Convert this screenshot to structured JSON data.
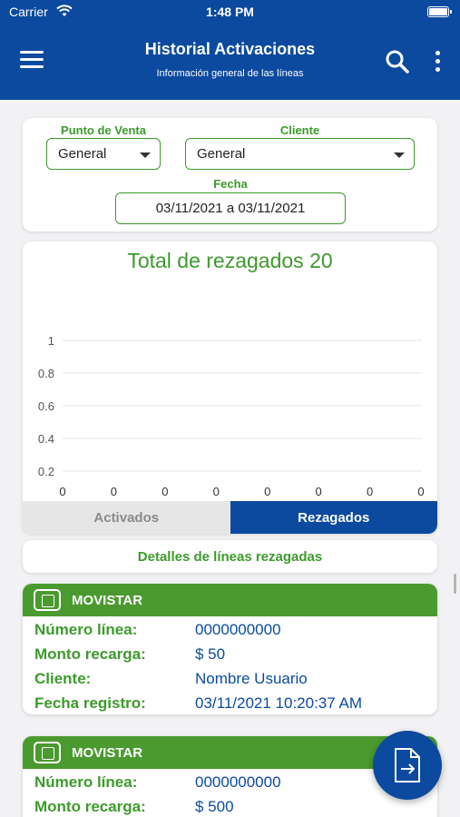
{
  "status_bar": {
    "carrier": "Carrier",
    "time": "1:48 PM"
  },
  "header": {
    "title": "Historial Activaciones",
    "subtitle": "Información general de las líneas"
  },
  "filters": {
    "punto_label": "Punto de Venta",
    "punto_value": "General",
    "cliente_label": "Cliente",
    "cliente_value": "General",
    "fecha_label": "Fecha",
    "fecha_value": "03/11/2021 a 03/11/2021"
  },
  "chart_data": {
    "type": "bar",
    "title": "Total de rezagados 20",
    "y_ticks": [
      "1",
      "0.8",
      "0.6",
      "0.4",
      "0.2"
    ],
    "ylim": [
      0,
      1
    ],
    "values": [
      0,
      0,
      0,
      0,
      0,
      0,
      0,
      0
    ],
    "value_labels": [
      "0",
      "0",
      "0",
      "0",
      "0",
      "0",
      "0",
      "0"
    ],
    "grid": true
  },
  "tabs": {
    "activados": "Activados",
    "rezagados": "Rezagados"
  },
  "details_title": "Detalles de líneas rezagadas",
  "lines": [
    {
      "carrier": "MOVISTAR",
      "rows": [
        {
          "key": "Número línea:",
          "value": "0000000000"
        },
        {
          "key": "Monto recarga:",
          "value": "$ 50"
        },
        {
          "key": "Cliente:",
          "value": "Nombre Usuario"
        },
        {
          "key": "Fecha registro:",
          "value": "03/11/2021 10:20:37 AM"
        }
      ]
    },
    {
      "carrier": "MOVISTAR",
      "rows": [
        {
          "key": "Número línea:",
          "value": "0000000000"
        },
        {
          "key": "Monto recarga:",
          "value": "$ 500"
        }
      ]
    }
  ],
  "colors": {
    "primary": "#0b4a9e",
    "green": "#3d9a2c",
    "card_green": "#4b9a2f"
  },
  "icons": {
    "menu": "menu-icon",
    "search": "search-icon",
    "more": "more-vert-icon",
    "sim": "sim-card-icon",
    "export": "file-export-icon"
  }
}
